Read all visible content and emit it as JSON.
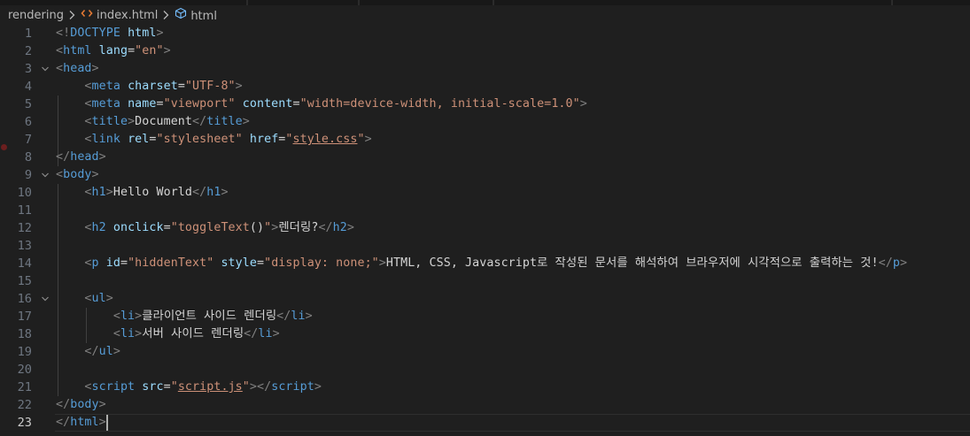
{
  "breadcrumb": {
    "items": [
      {
        "label": "rendering",
        "icon": ""
      },
      {
        "label": "index.html",
        "icon": "html-file-icon"
      },
      {
        "label": "html",
        "icon": "html-element-icon"
      }
    ]
  },
  "editor": {
    "active_line": 23,
    "breakpoint_line": 6,
    "lines": [
      {
        "n": "1",
        "fold": false,
        "tokens": [
          [
            "d",
            "<!"
          ],
          [
            "t",
            "DOCTYPE"
          ],
          [
            "x",
            " "
          ],
          [
            "a",
            "html"
          ],
          [
            "d",
            ">"
          ]
        ]
      },
      {
        "n": "2",
        "fold": false,
        "tokens": [
          [
            "d",
            "<"
          ],
          [
            "t",
            "html"
          ],
          [
            "x",
            " "
          ],
          [
            "a",
            "lang"
          ],
          [
            "x",
            "="
          ],
          [
            "s",
            "\"en\""
          ],
          [
            "d",
            ">"
          ]
        ]
      },
      {
        "n": "3",
        "fold": true,
        "tokens": [
          [
            "d",
            "<"
          ],
          [
            "t",
            "head"
          ],
          [
            "d",
            ">"
          ]
        ]
      },
      {
        "n": "4",
        "fold": false,
        "tokens": [
          [
            "x",
            "    "
          ],
          [
            "d",
            "<"
          ],
          [
            "t",
            "meta"
          ],
          [
            "x",
            " "
          ],
          [
            "a",
            "charset"
          ],
          [
            "x",
            "="
          ],
          [
            "s",
            "\"UTF-8\""
          ],
          [
            "d",
            ">"
          ]
        ]
      },
      {
        "n": "5",
        "fold": false,
        "tokens": [
          [
            "x",
            "    "
          ],
          [
            "d",
            "<"
          ],
          [
            "t",
            "meta"
          ],
          [
            "x",
            " "
          ],
          [
            "a",
            "name"
          ],
          [
            "x",
            "="
          ],
          [
            "s",
            "\"viewport\""
          ],
          [
            "x",
            " "
          ],
          [
            "a",
            "content"
          ],
          [
            "x",
            "="
          ],
          [
            "s",
            "\"width=device-width, initial-scale=1.0\""
          ],
          [
            "d",
            ">"
          ]
        ]
      },
      {
        "n": "6",
        "fold": false,
        "tokens": [
          [
            "x",
            "    "
          ],
          [
            "d",
            "<"
          ],
          [
            "t",
            "title"
          ],
          [
            "d",
            ">"
          ],
          [
            "x",
            "Document"
          ],
          [
            "d",
            "</"
          ],
          [
            "t",
            "title"
          ],
          [
            "d",
            ">"
          ]
        ]
      },
      {
        "n": "7",
        "fold": false,
        "tokens": [
          [
            "x",
            "    "
          ],
          [
            "d",
            "<"
          ],
          [
            "t",
            "link"
          ],
          [
            "x",
            " "
          ],
          [
            "a",
            "rel"
          ],
          [
            "x",
            "="
          ],
          [
            "s",
            "\"stylesheet\""
          ],
          [
            "x",
            " "
          ],
          [
            "a",
            "href"
          ],
          [
            "x",
            "="
          ],
          [
            "s",
            "\""
          ],
          [
            "u",
            "style.css"
          ],
          [
            "s",
            "\""
          ],
          [
            "d",
            ">"
          ]
        ]
      },
      {
        "n": "8",
        "fold": false,
        "tokens": [
          [
            "d",
            "</"
          ],
          [
            "t",
            "head"
          ],
          [
            "d",
            ">"
          ]
        ]
      },
      {
        "n": "9",
        "fold": true,
        "tokens": [
          [
            "d",
            "<"
          ],
          [
            "t",
            "body"
          ],
          [
            "d",
            ">"
          ]
        ]
      },
      {
        "n": "10",
        "fold": false,
        "tokens": [
          [
            "x",
            "    "
          ],
          [
            "d",
            "<"
          ],
          [
            "t",
            "h1"
          ],
          [
            "d",
            ">"
          ],
          [
            "x",
            "Hello World"
          ],
          [
            "d",
            "</"
          ],
          [
            "t",
            "h1"
          ],
          [
            "d",
            ">"
          ]
        ]
      },
      {
        "n": "11",
        "fold": false,
        "tokens": []
      },
      {
        "n": "12",
        "fold": false,
        "tokens": [
          [
            "x",
            "    "
          ],
          [
            "d",
            "<"
          ],
          [
            "t",
            "h2"
          ],
          [
            "x",
            " "
          ],
          [
            "a",
            "onclick"
          ],
          [
            "x",
            "="
          ],
          [
            "s",
            "\"toggleText"
          ],
          [
            "x",
            "()"
          ],
          [
            "s",
            "\""
          ],
          [
            "d",
            ">"
          ],
          [
            "x",
            "렌더링?"
          ],
          [
            "d",
            "</"
          ],
          [
            "t",
            "h2"
          ],
          [
            "d",
            ">"
          ]
        ]
      },
      {
        "n": "13",
        "fold": false,
        "tokens": []
      },
      {
        "n": "14",
        "fold": false,
        "tokens": [
          [
            "x",
            "    "
          ],
          [
            "d",
            "<"
          ],
          [
            "t",
            "p"
          ],
          [
            "x",
            " "
          ],
          [
            "a",
            "id"
          ],
          [
            "x",
            "="
          ],
          [
            "s",
            "\"hiddenText\""
          ],
          [
            "x",
            " "
          ],
          [
            "a",
            "style"
          ],
          [
            "x",
            "="
          ],
          [
            "s",
            "\"display: none;\""
          ],
          [
            "d",
            ">"
          ],
          [
            "x",
            "HTML, CSS, Javascript로 작성된 문서를 해석하여 브라우저에 시각적으로 출력하는 것!"
          ],
          [
            "d",
            "</"
          ],
          [
            "t",
            "p"
          ],
          [
            "d",
            ">"
          ]
        ]
      },
      {
        "n": "15",
        "fold": false,
        "tokens": []
      },
      {
        "n": "16",
        "fold": true,
        "tokens": [
          [
            "x",
            "    "
          ],
          [
            "d",
            "<"
          ],
          [
            "t",
            "ul"
          ],
          [
            "d",
            ">"
          ]
        ]
      },
      {
        "n": "17",
        "fold": false,
        "tokens": [
          [
            "x",
            "        "
          ],
          [
            "d",
            "<"
          ],
          [
            "t",
            "li"
          ],
          [
            "d",
            ">"
          ],
          [
            "x",
            "클라이언트 사이드 렌더링"
          ],
          [
            "d",
            "</"
          ],
          [
            "t",
            "li"
          ],
          [
            "d",
            ">"
          ]
        ]
      },
      {
        "n": "18",
        "fold": false,
        "tokens": [
          [
            "x",
            "        "
          ],
          [
            "d",
            "<"
          ],
          [
            "t",
            "li"
          ],
          [
            "d",
            ">"
          ],
          [
            "x",
            "서버 사이드 렌더링"
          ],
          [
            "d",
            "</"
          ],
          [
            "t",
            "li"
          ],
          [
            "d",
            ">"
          ]
        ]
      },
      {
        "n": "19",
        "fold": false,
        "tokens": [
          [
            "x",
            "    "
          ],
          [
            "d",
            "</"
          ],
          [
            "t",
            "ul"
          ],
          [
            "d",
            ">"
          ]
        ]
      },
      {
        "n": "20",
        "fold": false,
        "tokens": []
      },
      {
        "n": "21",
        "fold": false,
        "tokens": [
          [
            "x",
            "    "
          ],
          [
            "d",
            "<"
          ],
          [
            "t",
            "script"
          ],
          [
            "x",
            " "
          ],
          [
            "a",
            "src"
          ],
          [
            "x",
            "="
          ],
          [
            "s",
            "\""
          ],
          [
            "u",
            "script.js"
          ],
          [
            "s",
            "\""
          ],
          [
            "d",
            ">"
          ],
          [
            "d",
            "</"
          ],
          [
            "t",
            "script"
          ],
          [
            "d",
            ">"
          ]
        ]
      },
      {
        "n": "22",
        "fold": false,
        "tokens": [
          [
            "d",
            "</"
          ],
          [
            "t",
            "body"
          ],
          [
            "d",
            ">"
          ]
        ]
      },
      {
        "n": "23",
        "fold": false,
        "tokens": [
          [
            "d",
            "</"
          ],
          [
            "t",
            "html"
          ],
          [
            "d",
            ">"
          ]
        ]
      }
    ]
  },
  "colors": {
    "background": "#1f1f1f",
    "tag": "#569cd6",
    "attribute": "#9cdcfe",
    "string": "#ce9178",
    "delimiter": "#808080",
    "text": "#d4d4d4",
    "line_number": "#6e7681",
    "line_number_active": "#cccccc"
  }
}
